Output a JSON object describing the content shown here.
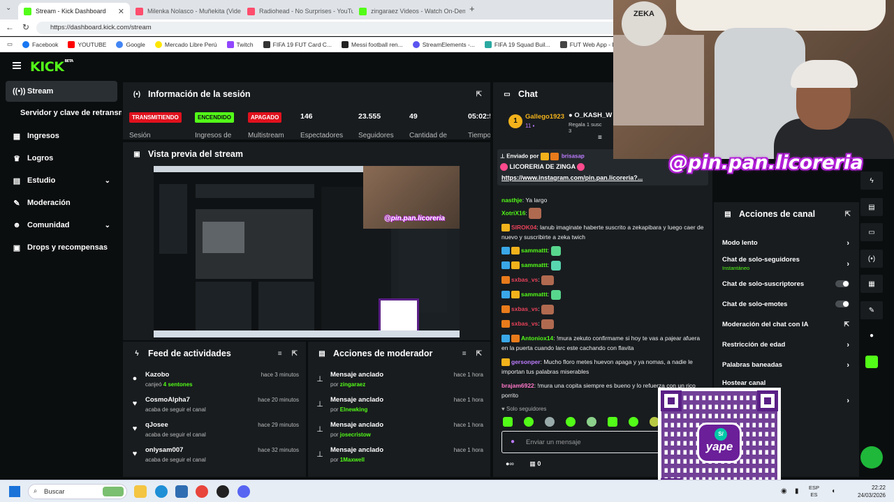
{
  "browser": {
    "tabs": [
      {
        "title": "Stream - Kick Dashboard",
        "color": "#53fc18"
      },
      {
        "title": "Milenka Nolasco - Muñekita (Vide",
        "color": "#ff4d6d"
      },
      {
        "title": "Radiohead - No Surprises - YouTu",
        "color": "#ff4d6d"
      },
      {
        "title": "zingaraez Videos - Watch On-Dem",
        "color": "#53fc18"
      }
    ],
    "url": "https://dashboard.kick.com/stream",
    "bookmarks": [
      {
        "label": "Facebook",
        "color": "#1877f2"
      },
      {
        "label": "YOUTUBE",
        "color": "#ff0000"
      },
      {
        "label": "Google",
        "color": "#4285f4"
      },
      {
        "label": "Mercado Libre Perú",
        "color": "#ffe600"
      },
      {
        "label": "Twitch",
        "color": "#9146ff"
      },
      {
        "label": "FIFA 19 FUT Card C...",
        "color": "#333333"
      },
      {
        "label": "Messi football ren...",
        "color": "#222222"
      },
      {
        "label": "StreamElements -...",
        "color": "#5a55f0"
      },
      {
        "label": "FIFA 19 Squad Buil...",
        "color": "#2aa9a1"
      },
      {
        "label": "FUT Web App - EA...",
        "color": "#444444"
      }
    ]
  },
  "sidebar": {
    "items": [
      {
        "label": "Stream",
        "icon": "broadcast-icon",
        "glyph": "((•))"
      },
      {
        "label": "Ingresos",
        "icon": "bank-icon",
        "glyph": "▦"
      },
      {
        "label": "Logros",
        "icon": "trophy-icon",
        "glyph": "🏆"
      },
      {
        "label": "Estudio",
        "icon": "layout-icon",
        "glyph": "▤"
      },
      {
        "label": "Moderación",
        "icon": "wrench-icon",
        "glyph": "🔧"
      },
      {
        "label": "Comunidad",
        "icon": "people-icon",
        "glyph": "👥"
      },
      {
        "label": "Drops y recompensas",
        "icon": "gift-icon",
        "glyph": "🎁"
      }
    ],
    "sub_item": "Servidor y clave de retransm"
  },
  "session": {
    "title": "Información de la sesión",
    "badges": [
      {
        "text": "TRANSMITIENDO",
        "bg": "#e0111d",
        "fg": "#ffffff",
        "label": "Sesión"
      },
      {
        "text": "ENCENDIDO",
        "bg": "#53fc18",
        "fg": "#0b0e0f",
        "label": "Ingresos de"
      },
      {
        "text": "APAGADO",
        "bg": "#e0111d",
        "fg": "#ffffff",
        "label": "Multistream"
      }
    ],
    "metrics": [
      {
        "value": "146",
        "label": "Espectadores"
      },
      {
        "value": "23.555",
        "label": "Seguidores"
      },
      {
        "value": "49",
        "label": "Cantidad de"
      },
      {
        "value": "05:02:5",
        "label": "Tiempo"
      }
    ]
  },
  "preview": {
    "title": "Vista previa del stream"
  },
  "activity": {
    "title": "Feed de actividades",
    "items": [
      {
        "icon": "people-icon",
        "glyph": "●",
        "name": "Kazobo",
        "action": "canjeó ",
        "highlight": "4 sentones",
        "time": "hace 3 minutos"
      },
      {
        "icon": "heart-icon",
        "glyph": "♥",
        "name": "CosmoAlpha7",
        "action": "acaba de seguir el canal",
        "highlight": "",
        "time": "hace 20 minutos"
      },
      {
        "icon": "heart-icon",
        "glyph": "♥",
        "name": "qJosee",
        "action": "acaba de seguir el canal",
        "highlight": "",
        "time": "hace 29 minutos"
      },
      {
        "icon": "heart-icon",
        "glyph": "♥",
        "name": "onlysam007",
        "action": "acaba de seguir el canal",
        "highlight": "",
        "time": "hace 32 minutos"
      }
    ]
  },
  "modactions": {
    "title": "Acciones de moderador",
    "items": [
      {
        "name": "Mensaje anclado",
        "by": "por ",
        "user": "zingaraez",
        "time": "hace 1 hora"
      },
      {
        "name": "Mensaje anclado",
        "by": "por ",
        "user": "Elnewking",
        "time": "hace 1 hora"
      },
      {
        "name": "Mensaje anclado",
        "by": "por ",
        "user": "josecristow",
        "time": "hace 1 hora"
      },
      {
        "name": "Mensaje anclado",
        "by": "por ",
        "user": "1Maxwell",
        "time": "hace 1 hora"
      }
    ]
  },
  "chat": {
    "title": "Chat",
    "leader_rank": "1",
    "leader_name": "Gallego1923",
    "leader_count": "11",
    "gifter_name": "O_KASH_W",
    "gifter_note": "Regala 1 susc",
    "gifter_count": "3",
    "pinned": {
      "sent_by": "Enviado por",
      "sender": "brisasap",
      "title": "LICORERIA DE ZINGA",
      "link": "https://www.instagram.com/pin.pan.licoreria?..."
    },
    "messages": [
      {
        "user": "nasthje",
        "color": "#53fc18",
        "text": "Ya largo",
        "badges": ""
      },
      {
        "user": "XotriX16",
        "color": "#53fc18",
        "text": "",
        "badges": "",
        "emote": "#b06a50"
      },
      {
        "user": "SIROK04",
        "color": "#e8425a",
        "text": "lanub imaginate haberte suscrito a zekapibara y luego caer de nuevo y suscribirte a zeka twich",
        "badges": "crown"
      },
      {
        "user": "sammattt",
        "color": "#53fc18",
        "text": "",
        "badges": "sword crown",
        "emote": "#58d68d"
      },
      {
        "user": "sammattt",
        "color": "#53fc18",
        "text": "",
        "badges": "sword crown",
        "emote": "#58d6b0"
      },
      {
        "user": "sxbas_vs",
        "color": "#e8425a",
        "text": "",
        "badges": "crown",
        "emote": "#b06a50"
      },
      {
        "user": "sammattt",
        "color": "#53fc18",
        "text": "",
        "badges": "sword crown",
        "emote": "#58d68d"
      },
      {
        "user": "sxbas_vs",
        "color": "#e8425a",
        "text": "",
        "badges": "crown",
        "emote": "#b06a50"
      },
      {
        "user": "sxbas_vs",
        "color": "#e8425a",
        "text": "",
        "badges": "crown",
        "emote": "#b06a50"
      },
      {
        "user": "Antoniox14",
        "color": "#53fc18",
        "text": "!mura zekuto confirmame si hoy te vas a pajear afuera en la puerta cuando larc este cachando con flavita",
        "badges": "sword crown"
      },
      {
        "user": "gersonper",
        "color": "#bd7cff",
        "text": "Mucho floro metes huevon apaga y ya nomas, a nadie le importan tus palabras miserables",
        "badges": "crown"
      },
      {
        "user": "brajam6922",
        "color": "#ff77c8",
        "text": "!mura una copita siempre es bueno y lo refuerza con un rico porrito",
        "badges": ""
      }
    ],
    "followers_only": "Solo seguidores",
    "input_placeholder": "Enviar un mensaje",
    "points": "0"
  },
  "channel_actions": {
    "title": "Acciones de canal",
    "items": [
      {
        "label": "Modo lento",
        "sub": "",
        "control": "arrow"
      },
      {
        "label": "Chat de solo-seguidores",
        "sub": "Instantáneo",
        "control": "arrow"
      },
      {
        "label": "Chat de solo-suscriptores",
        "sub": "",
        "control": "toggle"
      },
      {
        "label": "Chat de solo-emotes",
        "sub": "",
        "control": "toggle"
      },
      {
        "label": "Moderación del chat con IA",
        "sub": "",
        "control": "external"
      },
      {
        "label": "Restricción de edad",
        "sub": "",
        "control": "arrow"
      },
      {
        "label": "Palabras baneadas",
        "sub": "",
        "control": "arrow"
      },
      {
        "label": "Hostear canal",
        "sub": "",
        "control": "none"
      }
    ]
  },
  "overlay": {
    "handle": "@pin.pan.licoreria",
    "qr_brand": "yape",
    "webcam_sign": "ZEKA"
  },
  "taskbar": {
    "search": "Buscar",
    "lang1": "ESP",
    "lang2": "ES",
    "time": "22:22",
    "date": "24/03/2026"
  }
}
